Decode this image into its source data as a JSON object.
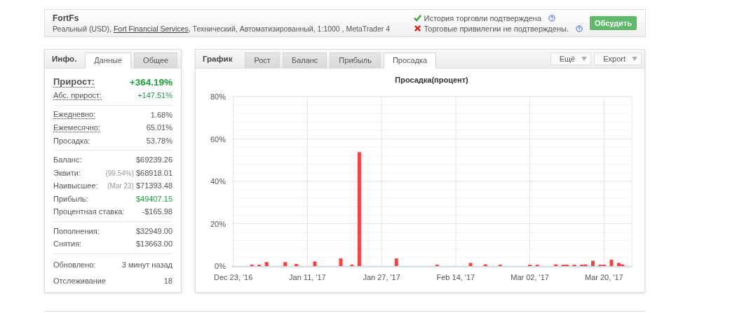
{
  "account": {
    "title": "FortFs",
    "details_before": "Реальный (USD), ",
    "broker_link": "Fort Financial Services",
    "details_after": ", Технический, Автоматизированный, 1:1000 , MetaTrader 4",
    "verifications": [
      {
        "text": "История торговли подтверждена",
        "verified": true
      },
      {
        "text": "Торговые привилегии не подтверждены.",
        "verified": false
      }
    ],
    "discuss_button": "Обсудить"
  },
  "info": {
    "label": "Инфо.",
    "tabs": [
      {
        "label": "Данные",
        "selected": true
      },
      {
        "label": "Общее",
        "selected": false
      }
    ],
    "groups": [
      [
        {
          "kind": "main",
          "label": "Прирост:",
          "value": "+364.19%",
          "dotted": true,
          "positive": true
        },
        {
          "kind": "row",
          "label": "Абс. прирост:",
          "value": "+147.51%",
          "dotted": true,
          "positive": true
        }
      ],
      [
        {
          "kind": "row",
          "label": "Ежедневно:",
          "value": "1.68%",
          "dotted": true,
          "positive": false
        },
        {
          "kind": "row",
          "label": "Ежемесячно:",
          "value": "65.01%",
          "dotted": true,
          "positive": false
        },
        {
          "kind": "row",
          "label": "Просадка:",
          "value": "53.78%",
          "dotted": false,
          "positive": false
        }
      ],
      [
        {
          "kind": "row",
          "label": "Баланс:",
          "value": "$69239.26",
          "dotted": false,
          "positive": false
        },
        {
          "kind": "row",
          "label": "Эквити:",
          "note": "(99.54%)",
          "value": "$68918.01",
          "dotted": false,
          "positive": false
        },
        {
          "kind": "row",
          "label": "Наивысшее:",
          "note": "(Mar 23)",
          "value": "$71393.48",
          "dotted": false,
          "positive": false
        },
        {
          "kind": "row",
          "label": "Прибыль:",
          "value": "$49407.15",
          "dotted": false,
          "positive": true
        },
        {
          "kind": "row",
          "label": "Процентная ставка:",
          "value": "-$165.98",
          "dotted": false,
          "positive": false
        }
      ],
      [
        {
          "kind": "row",
          "label": "Пополнения:",
          "value": "$32949.00",
          "dotted": false,
          "positive": false
        },
        {
          "kind": "row",
          "label": "Снятия:",
          "value": "$13663.00",
          "dotted": false,
          "positive": false
        }
      ],
      [
        {
          "kind": "tall",
          "label": "Обновлено:",
          "value": "3 минут назад",
          "dotted": false,
          "positive": false
        },
        {
          "kind": "tall",
          "label": "Отслеживание",
          "value": "18",
          "dotted": false,
          "positive": false
        }
      ]
    ]
  },
  "chart_panel": {
    "label": "График",
    "tabs": [
      {
        "label": "Рост",
        "selected": false
      },
      {
        "label": "Баланс",
        "selected": false
      },
      {
        "label": "Прибыль",
        "selected": false
      },
      {
        "label": "Просадка",
        "selected": true
      }
    ],
    "dropdowns": [
      "Ещё",
      "Export"
    ],
    "chart_data": {
      "type": "bar",
      "title": "Просадка(процент)",
      "grid": true,
      "ylim": [
        0,
        80
      ],
      "categories": [
        "Dec 23, '16",
        null,
        null,
        null,
        null,
        null,
        null,
        null,
        null,
        null,
        null,
        null,
        null,
        null,
        null,
        null,
        null,
        null,
        null,
        null,
        "Jan 11, '17",
        null,
        null,
        null,
        null,
        null,
        null,
        null,
        null,
        null,
        null,
        null,
        null,
        null,
        null,
        null,
        null,
        null,
        null,
        null,
        "Jan 27, '17",
        null,
        null,
        null,
        null,
        null,
        null,
        null,
        null,
        null,
        null,
        null,
        null,
        null,
        null,
        null,
        null,
        null,
        null,
        null,
        "Feb 14, '17",
        null,
        null,
        null,
        null,
        null,
        null,
        null,
        null,
        null,
        null,
        null,
        null,
        null,
        null,
        null,
        null,
        null,
        null,
        null,
        "Mar 02, '17",
        null,
        null,
        null,
        null,
        null,
        null,
        null,
        null,
        null,
        null,
        null,
        null,
        null,
        null,
        null,
        null,
        null,
        null,
        null,
        "Mar 20, '17",
        null,
        null,
        null,
        null,
        null,
        null,
        null
      ],
      "yticks": [
        {
          "value": 0,
          "label": "0%"
        },
        {
          "value": 20,
          "label": "20%"
        },
        {
          "value": 40,
          "label": "40%"
        },
        {
          "value": 60,
          "label": "60%"
        },
        {
          "value": 80,
          "label": "80%"
        }
      ],
      "series": [
        {
          "color": "#ff4040",
          "values": [
            null,
            null,
            null,
            null,
            null,
            0.7,
            null,
            0.3,
            null,
            1.9,
            null,
            null,
            null,
            null,
            1.9,
            null,
            null,
            1.0,
            null,
            null,
            null,
            null,
            2.2,
            null,
            null,
            null,
            null,
            null,
            null,
            3.6,
            null,
            null,
            0.7,
            null,
            53.8,
            null,
            null,
            null,
            null,
            null,
            null,
            null,
            null,
            null,
            3.6,
            null,
            null,
            null,
            null,
            null,
            null,
            null,
            null,
            null,
            null,
            0.3,
            null,
            null,
            null,
            null,
            null,
            null,
            null,
            null,
            1.5,
            null,
            null,
            null,
            0.8,
            null,
            null,
            null,
            0.3,
            null,
            null,
            null,
            null,
            null,
            null,
            null,
            0.3,
            null,
            0.3,
            null,
            null,
            null,
            null,
            0.8,
            null,
            0.3,
            0.3,
            null,
            0.3,
            null,
            0.3,
            0.8,
            null,
            2.5,
            null,
            0.3,
            0.3,
            null,
            3.0,
            null,
            1.5,
            0.8,
            null,
            null
          ]
        }
      ]
    }
  }
}
